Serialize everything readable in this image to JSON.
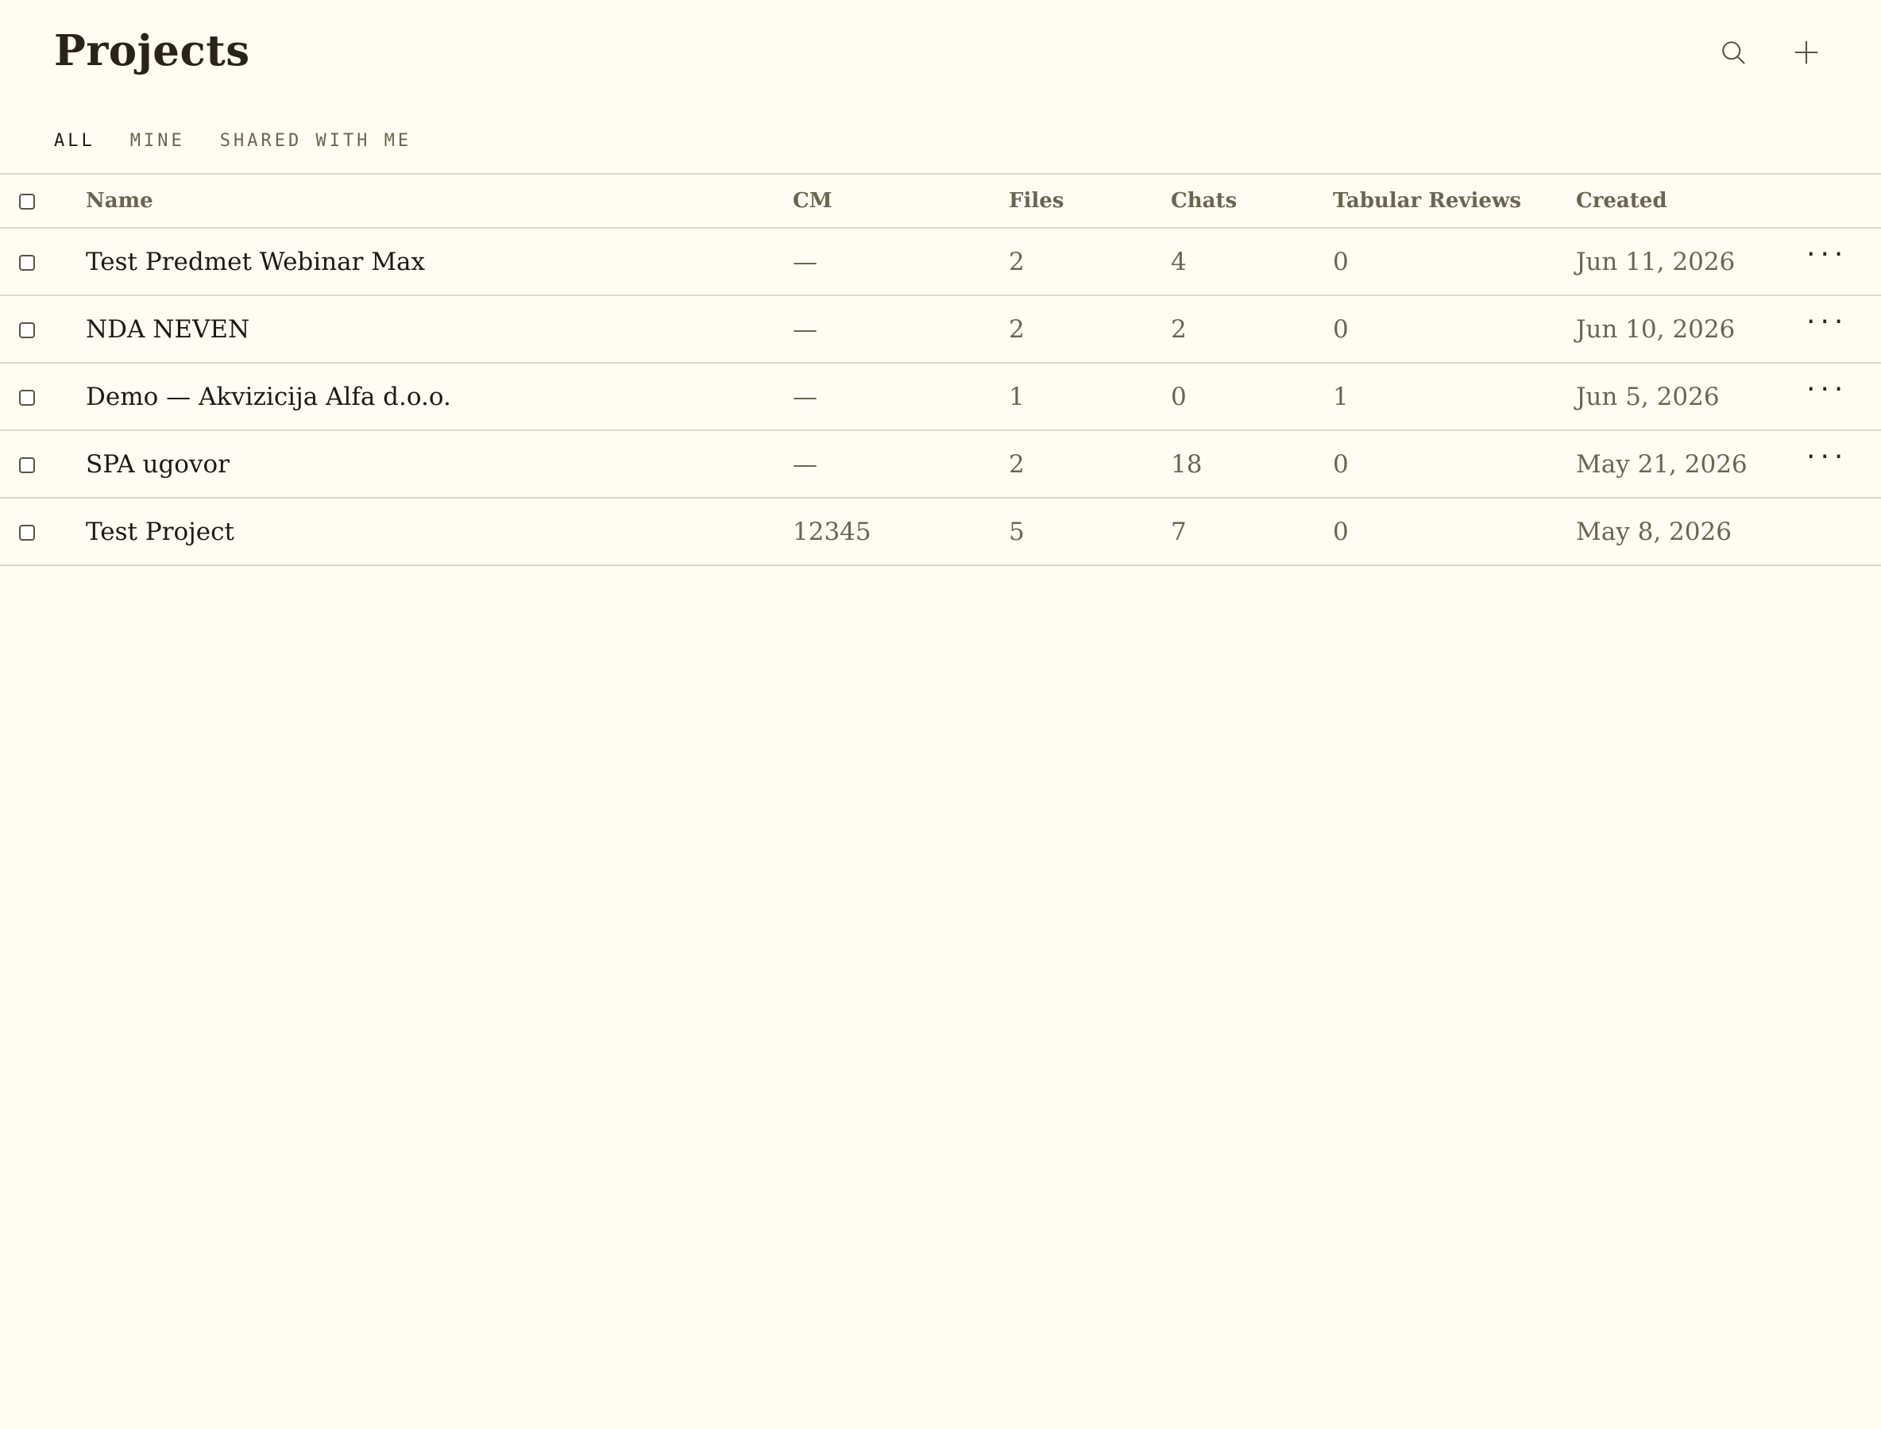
{
  "page": {
    "title": "Projects"
  },
  "toolbar": {
    "search_icon": "search-icon",
    "add_icon": "plus-icon"
  },
  "tabs": [
    {
      "label": "ALL",
      "active": true
    },
    {
      "label": "MINE",
      "active": false
    },
    {
      "label": "SHARED WITH ME",
      "active": false
    }
  ],
  "table": {
    "headers": {
      "name": "Name",
      "cm": "CM",
      "files": "Files",
      "chats": "Chats",
      "tabular_reviews": "Tabular Reviews",
      "created": "Created"
    },
    "rows": [
      {
        "name": "Test Predmet Webinar Max",
        "cm": "—",
        "files": "2",
        "chats": "4",
        "tabular_reviews": "0",
        "created": "Jun 11, 2026",
        "more": "···"
      },
      {
        "name": "NDA NEVEN",
        "cm": "—",
        "files": "2",
        "chats": "2",
        "tabular_reviews": "0",
        "created": "Jun 10, 2026",
        "more": "···"
      },
      {
        "name": "Demo — Akvizicija Alfa d.o.o.",
        "cm": "—",
        "files": "1",
        "chats": "0",
        "tabular_reviews": "1",
        "created": "Jun 5, 2026",
        "more": "···"
      },
      {
        "name": "SPA ugovor",
        "cm": "—",
        "files": "2",
        "chats": "18",
        "tabular_reviews": "0",
        "created": "May 21, 2026",
        "more": "···"
      },
      {
        "name": "Test Project",
        "cm": "12345",
        "files": "5",
        "chats": "7",
        "tabular_reviews": "0",
        "created": "May 8, 2026",
        "more": ""
      }
    ]
  },
  "colors": {
    "background": "#fffcf4",
    "text": "#2a2418",
    "muted": "#6b6450",
    "divider": "#dcd7ca"
  }
}
